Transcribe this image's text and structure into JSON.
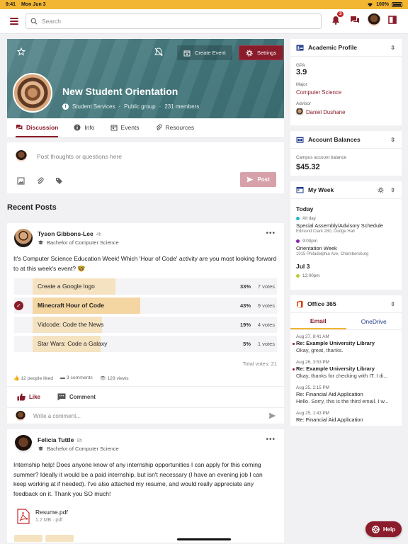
{
  "status_bar": {
    "time": "9:41",
    "date": "Mon Jun 3",
    "battery": "100%"
  },
  "topbar": {
    "search_placeholder": "Search",
    "notification_count": "3"
  },
  "group": {
    "title": "New Student Orientation",
    "department": "Student Services",
    "visibility": "Public group",
    "members": "231 members",
    "create_event_label": "Create Event",
    "settings_label": "Settings"
  },
  "tabs": [
    {
      "label": "Discussion",
      "active": true
    },
    {
      "label": "Info"
    },
    {
      "label": "Events"
    },
    {
      "label": "Resources"
    }
  ],
  "composer": {
    "placeholder": "Post thoughts or questions here",
    "post_label": "Post"
  },
  "recent_posts_heading": "Recent Posts",
  "posts": [
    {
      "author": "Tyson Gibbons-Lee",
      "time": "4h",
      "degree": "Bachelor of Computer Science",
      "body": "It's Computer Science Education Week! Which 'Hour of Code' activity are you most looking forward to at this week's event? 🤓",
      "poll": [
        {
          "label": "Create a Google logo",
          "percent": "33%",
          "votes": "7 votes",
          "share": 33,
          "selected": false
        },
        {
          "label": "Minecraft Hour of Code",
          "percent": "43%",
          "votes": "9 votes",
          "share": 43,
          "selected": true
        },
        {
          "label": "Vidcode: Code the News",
          "percent": "19%",
          "votes": "4 votes",
          "share": 19,
          "selected": false
        },
        {
          "label": "Star Wars: Code a Galaxy",
          "percent": "5%",
          "votes": "1 votes",
          "share": 5,
          "selected": false
        }
      ],
      "total_votes": "Total votes: 21",
      "likes": "12 people liked",
      "comments": "3 comments",
      "views": "129 views",
      "like_label": "Like",
      "comment_label": "Comment",
      "comment_placeholder": "Write a comment..."
    },
    {
      "author": "Felicia Tuttle",
      "time": "8h",
      "degree": "Bachelor of Computer Science",
      "body": "Internship help! Does anyone know of any internship opportunities I can apply for this coming summer? Ideally it would be a paid internship, but isn't necessary (I have an evening job I can keep working at if needed). I've also attached my resume, and would really appreciate any feedback on it. Thank you SO much!",
      "attachment": {
        "name": "Resume.pdf",
        "size": "1.2 MB",
        "type": "pdf"
      }
    }
  ],
  "academic_profile": {
    "title": "Academic Profile",
    "gpa_label": "GPA",
    "gpa": "3.9",
    "major_label": "Major",
    "major": "Computer Science",
    "advisor_label": "Advisor",
    "advisor": "Daniel Dushane"
  },
  "account_balances": {
    "title": "Account Balances",
    "label": "Campus account balance",
    "amount": "$45.32"
  },
  "my_week": {
    "title": "My Week",
    "days": [
      {
        "day": "Today",
        "events": [
          {
            "when": "All day",
            "title": "Special Assembly/Advisory Schedule",
            "location": "Edmund Clark 280, Dodge Hall",
            "color": "#26b5c9"
          },
          {
            "when": "9:00pm",
            "title": "Orientation Week",
            "location": "1015 Philadelphia Ave, Chambersburg",
            "color": "#8e24aa"
          }
        ]
      },
      {
        "day": "Jul 3",
        "events": [
          {
            "when": "12:00pm",
            "color": "#c0ca33"
          }
        ]
      }
    ]
  },
  "office365": {
    "title": "Office 365",
    "tab_email": "Email",
    "tab_onedrive": "OneDrive",
    "emails": [
      {
        "date": "Aug 27, 8:41 AM",
        "subject": "Re: Example University Library",
        "preview": "Okay, great, thanks.",
        "unread": true
      },
      {
        "date": "Aug 26, 3:53 PM",
        "subject": "Re: Example University Library",
        "preview": "Okay, thanks for checking with IT. I di...",
        "unread": true
      },
      {
        "date": "Aug 25, 2:15 PM",
        "subject": "Re: Financial Aid Application",
        "preview": "Hello. Sorry, this is the third email. I w...",
        "unread": false
      },
      {
        "date": "Aug 25, 1:43 PM",
        "subject": "Re: Financial Aid Application",
        "preview": "",
        "unread": false
      }
    ]
  },
  "help_label": "Help",
  "colors": {
    "brand": "#8a1c2b",
    "accent": "#f2b632",
    "banner": "#4a7f84"
  }
}
